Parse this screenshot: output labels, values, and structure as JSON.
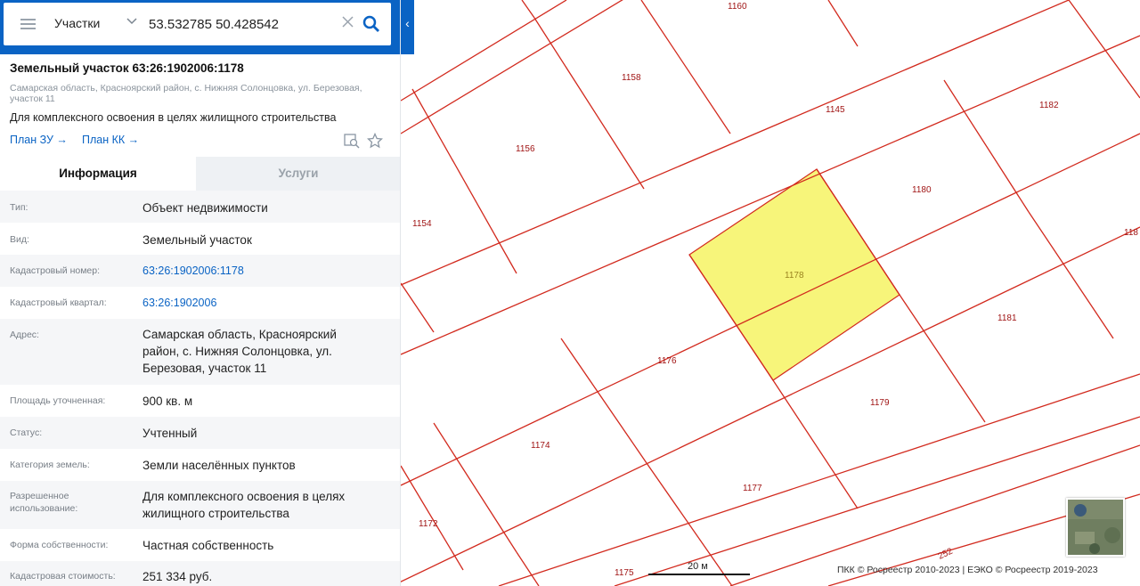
{
  "search": {
    "type_label": "Участки",
    "query": "53.532785 50.428542"
  },
  "object": {
    "title": "Земельный участок 63:26:1902006:1178",
    "address": "Самарская область, Красноярский район, с. Нижняя Солонцовка, ул. Березовая, участок 11",
    "use": "Для комплексного освоения в целях жилищного строительства",
    "plan_zu": "План ЗУ →",
    "plan_kk": "План КК →"
  },
  "tabs": {
    "info": "Информация",
    "services": "Услуги"
  },
  "info_rows": {
    "type": {
      "key": "Тип:",
      "value": "Объект недвижимости"
    },
    "kind": {
      "key": "Вид:",
      "value": "Земельный участок"
    },
    "cad_num": {
      "key": "Кадастровый номер:",
      "value": "63:26:1902006:1178"
    },
    "cad_block": {
      "key": "Кадастровый квартал:",
      "value": "63:26:1902006"
    },
    "address": {
      "key": "Адрес:",
      "value": "Самарская область, Красноярский район, с. Нижняя Солонцовка, ул. Березовая, участок 11"
    },
    "area": {
      "key": "Площадь уточненная:",
      "value": "900 кв. м"
    },
    "status": {
      "key": "Статус:",
      "value": "Учтенный"
    },
    "category": {
      "key": "Категория земель:",
      "value": "Земли населённых пунктов"
    },
    "permitted_use": {
      "key": "Разрешенное использование:",
      "value": "Для комплексного освоения в целях жилищного строительства"
    },
    "ownership": {
      "key": "Форма собственности:",
      "value": "Частная собственность"
    },
    "cost": {
      "key": "Кадастровая стоимость:",
      "value": "251 334 руб."
    }
  },
  "map": {
    "plot_labels": {
      "p1160": "1160",
      "p1158": "1158",
      "p1145": "1145",
      "p1182": "1182",
      "p1156": "1156",
      "p1180": "1180",
      "p1154": "1154",
      "p118x": "118",
      "p1178": "1178",
      "p1181": "1181",
      "p1176": "1176",
      "p1179": "1179",
      "p1174": "1174",
      "p1177": "1177",
      "p1172": "1172",
      "p1175": "1175",
      "p252": "252"
    },
    "scale_label": "20 м",
    "attribution": "ПКК © Росреестр 2010-2023 | ЕЭКО © Росреестр 2019-2023",
    "boundary_color": "#d22a1e",
    "selected_fill": "#f7f57a"
  },
  "icons": [
    "menu-icon",
    "chevron-down-icon",
    "close-icon",
    "search-icon",
    "collapse-chevron-icon",
    "search-plan-icon",
    "star-icon",
    "home-icon"
  ]
}
